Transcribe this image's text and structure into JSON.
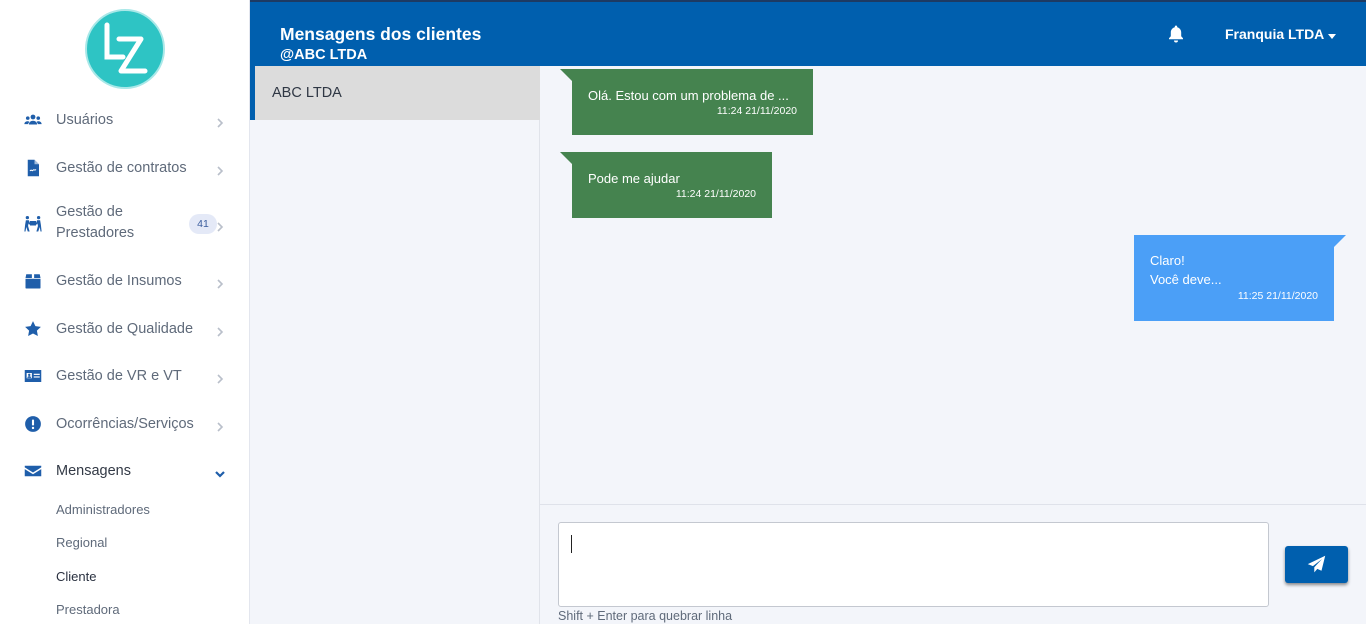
{
  "logo": {
    "text": "LZ"
  },
  "sidebar": {
    "items": [
      {
        "label": "Usuários",
        "icon": "users-icon"
      },
      {
        "label": "Gestão de contratos",
        "icon": "contract-file-icon"
      },
      {
        "label_line1": "Gestão de",
        "label_line2": "Prestadores",
        "badge": "41",
        "icon": "people-carry-icon"
      },
      {
        "label": "Gestão de Insumos",
        "icon": "box-icon"
      },
      {
        "label": "Gestão de Qualidade",
        "icon": "star-icon"
      },
      {
        "label": "Gestão de VR e VT",
        "icon": "id-card-icon"
      },
      {
        "label": "Ocorrências/Serviços",
        "icon": "exclamation-circle-icon"
      },
      {
        "label": "Mensagens",
        "icon": "envelope-icon",
        "expanded": true
      }
    ],
    "submenu": [
      "Administradores",
      "Regional",
      "Cliente",
      "Prestadora"
    ],
    "active_submenu": "Cliente"
  },
  "header": {
    "title": "Mensagens dos clientes",
    "subtitle": "@ABC LTDA",
    "user": "Franquia LTDA",
    "bell_icon": "bell-icon"
  },
  "conversations": [
    {
      "name": "ABC LTDA",
      "selected": true
    }
  ],
  "messages": [
    {
      "direction": "in",
      "lines": [
        "Olá. Estou com um problema de ..."
      ],
      "time": "11:24 21/11/2020"
    },
    {
      "direction": "in",
      "lines": [
        "Pode me ajudar"
      ],
      "time": "11:24 21/11/2020"
    },
    {
      "direction": "out",
      "lines": [
        "Claro!",
        "Você deve..."
      ],
      "time": "11:25 21/11/2020"
    }
  ],
  "composer": {
    "value": "",
    "hint": "Shift + Enter para quebrar linha",
    "send_icon": "paper-plane-icon"
  },
  "colors": {
    "header_bg": "#005fae",
    "incoming_bubble": "#45834f",
    "outgoing_bubble": "#4b9ff7",
    "icon_blue": "#1f5eaa",
    "logo_teal": "#2ec4c4"
  }
}
